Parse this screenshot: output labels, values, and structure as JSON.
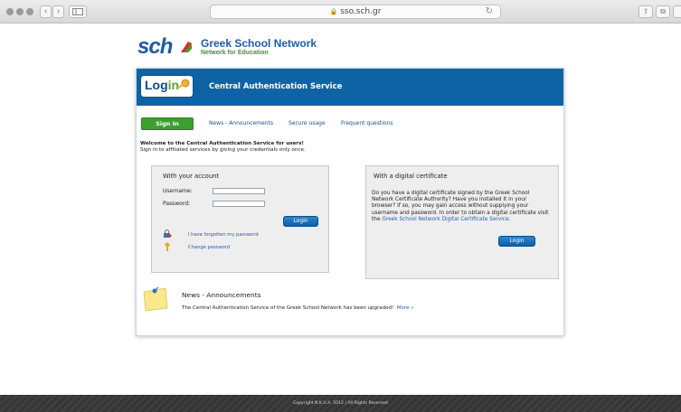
{
  "browser": {
    "url": "sso.sch.gr",
    "back_symbol": "‹",
    "forward_symbol": "›"
  },
  "logo": {
    "brand": "sch",
    "title": "Greek School Network",
    "subtitle": "Network for Education"
  },
  "header": {
    "login_word_a": "Log",
    "login_word_b": "in",
    "title": "Central Authentication Service"
  },
  "tabs": [
    {
      "label": "Sign In",
      "active": true
    },
    {
      "label": "News - Announcements",
      "active": false
    },
    {
      "label": "Secure usage",
      "active": false
    },
    {
      "label": "Frequent questions",
      "active": false
    }
  ],
  "welcome": {
    "heading": "Welcome to the Central Authentication Service for users!",
    "text": "Sign in to affiliated services by giving your credentials only once."
  },
  "account_panel": {
    "title": "With your account",
    "username_label": "Username:",
    "username_value": "",
    "password_label": "Password:",
    "password_value": "",
    "login_button": "Login",
    "forgot_link": "I have forgotten my password",
    "change_link": "Change password"
  },
  "cert_panel": {
    "title": "With a digital certificate",
    "text": "Do you have a digital certificate signed by the Greek School Network Certificate Authority? Have you installed it in your browser? If so, you may gain access without supplying your username and password. In order to obtain a digital certificate visit the ",
    "link": "Greek School Network Digital Certificate Service.",
    "login_button": "Login"
  },
  "news": {
    "title": "News - Announcements",
    "text": "The Central Authentication Service of the Greek School Network has been upgraded!",
    "more": "More »"
  },
  "footer": {
    "copyright": "Copyright N.K.U.A. 2012 | All Rights Reserved"
  },
  "colors": {
    "header_blue": "#0e63a6",
    "tab_green": "#3c9f2e",
    "link_blue": "#1a5fb0",
    "footer_dark": "#3a3a3a"
  }
}
